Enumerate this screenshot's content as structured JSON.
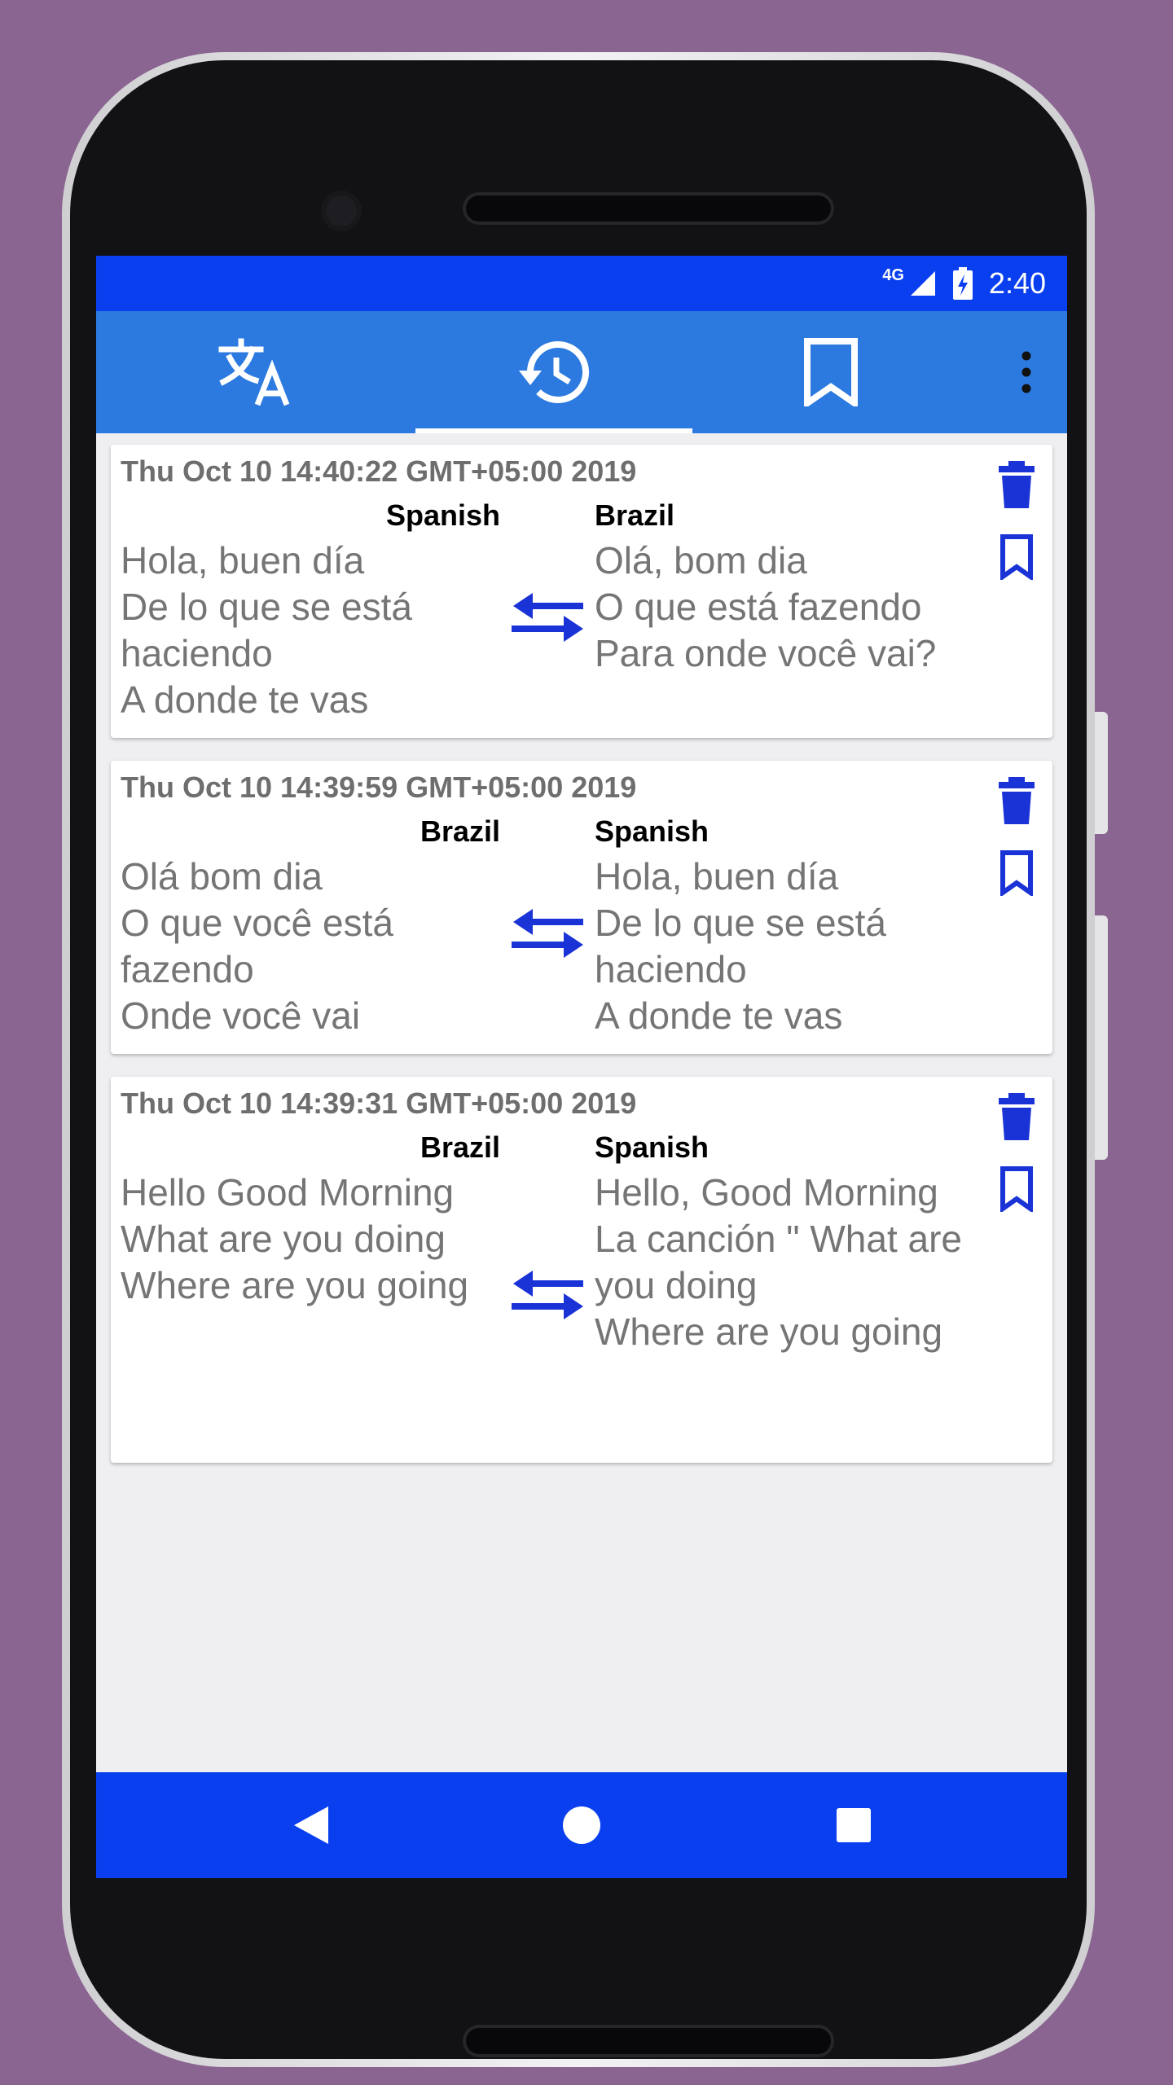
{
  "status_bar": {
    "network": "4G",
    "time": "2:40"
  },
  "tabs": [
    {
      "name": "translate",
      "icon": "translate-icon"
    },
    {
      "name": "history",
      "icon": "history-icon",
      "selected": true
    },
    {
      "name": "bookmarks",
      "icon": "bookmark-icon"
    }
  ],
  "history": [
    {
      "timestamp": "Thu Oct 10 14:40:22 GMT+05:00 2019",
      "source_lang": "Spanish",
      "target_lang": "Brazil",
      "source_text": "Hola, buen día\nDe lo que se está haciendo\nA donde te vas",
      "target_text": "Olá, bom dia\nO que está fazendo\nPara onde você vai?"
    },
    {
      "timestamp": "Thu Oct 10 14:39:59 GMT+05:00 2019",
      "source_lang": "Brazil",
      "target_lang": "Spanish",
      "source_text": "Olá bom dia\nO que você está fazendo\nOnde você vai",
      "target_text": "Hola, buen día\nDe lo que se está haciendo\nA donde te vas"
    },
    {
      "timestamp": "Thu Oct 10 14:39:31 GMT+05:00 2019",
      "source_lang": "Brazil",
      "target_lang": "Spanish",
      "source_text": "Hello Good Morning\nWhat are you doing\nWhere are you going",
      "target_text": "Hello, Good Morning\nLa canción \" What are you doing\nWhere are you going"
    }
  ],
  "colors": {
    "status_bar": "#0a3ff0",
    "app_bar": "#2c7ae0",
    "icon_blue": "#1a33d6",
    "background": "#8b6591"
  }
}
